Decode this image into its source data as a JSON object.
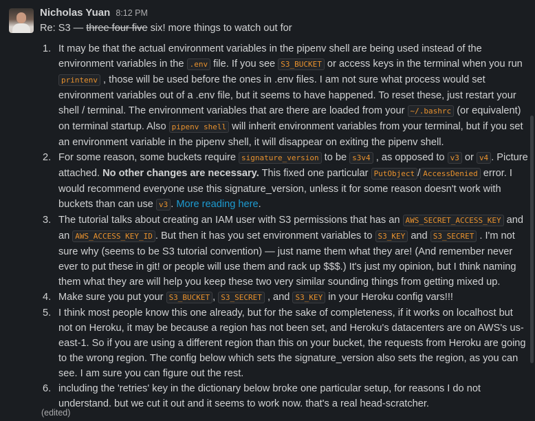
{
  "message": {
    "author": "Nicholas Yuan",
    "time": "8:12 PM",
    "subject": {
      "before": "Re: S3 — ",
      "struck": "three four five",
      "after": " six! more things to watch out for"
    },
    "items": [
      {
        "n": "1.",
        "parts": [
          {
            "t": "It may be that the actual environment variables in the pipenv shell are being used instead of the environment variables in the "
          },
          {
            "c": ".env"
          },
          {
            "t": " file. If you see "
          },
          {
            "c": "S3_BUCKET"
          },
          {
            "t": " or access keys in the terminal when you run "
          },
          {
            "c": "printenv"
          },
          {
            "t": " , those will be used before the ones in .env files. I am not sure what process would set environment variables out of a .env file, but it seems to have happened. To reset these, just restart your shell / terminal. The environment variables that are there are loaded from your "
          },
          {
            "c": "~/.bashrc"
          },
          {
            "t": " (or equivalent) on terminal startup. Also "
          },
          {
            "c": "pipenv shell"
          },
          {
            "t": " will inherit environment variables from your terminal, but if you set an environment variable in the pipenv shell, it will disappear on exiting the pipenv shell."
          }
        ]
      },
      {
        "n": "2.",
        "parts": [
          {
            "t": "For some reason, some buckets require "
          },
          {
            "c": "signature_version"
          },
          {
            "t": " to be "
          },
          {
            "c": "s3v4"
          },
          {
            "t": " , as opposed to "
          },
          {
            "c": "v3"
          },
          {
            "t": " or "
          },
          {
            "c": "v4"
          },
          {
            "t": ". Picture attached. "
          },
          {
            "b": "No other changes are necessary."
          },
          {
            "t": " This fixed one particular "
          },
          {
            "c": "PutObject"
          },
          {
            "t": "/"
          },
          {
            "c": "AccessDenied"
          },
          {
            "t": " error. I would recommend everyone use this signature_version, unless it for some reason doesn't work with buckets than can use "
          },
          {
            "c": "v3"
          },
          {
            "t": ". "
          },
          {
            "a": "More reading here"
          },
          {
            "t": "."
          }
        ]
      },
      {
        "n": "3.",
        "parts": [
          {
            "t": "The tutorial talks about creating an IAM user with S3 permissions that has an "
          },
          {
            "c": "AWS_SECRET_ACCESS_KEY"
          },
          {
            "t": " and an "
          },
          {
            "c": "AWS_ACCESS_KEY_ID"
          },
          {
            "t": ". But then it has you set environment variables to "
          },
          {
            "c": "S3_KEY"
          },
          {
            "t": " and "
          },
          {
            "c": "S3_SECRET"
          },
          {
            "t": " . I'm not sure why (seems to be S3 tutorial convention) — just name them what they are! (And remember never ever to put these in git! or people will use them and rack up $$$.) It's just my opinion, but I think naming them what they are will help you keep these two very similar sounding things from getting mixed up."
          }
        ]
      },
      {
        "n": "4.",
        "parts": [
          {
            "t": "Make sure you put your "
          },
          {
            "c": "S3_BUCKET"
          },
          {
            "t": ", "
          },
          {
            "c": "S3_SECRET"
          },
          {
            "t": " , and "
          },
          {
            "c": "S3_KEY"
          },
          {
            "t": " in your Heroku config vars!!!"
          }
        ]
      },
      {
        "n": "5.",
        "parts": [
          {
            "t": "I think most people know this one already, but for the sake of completeness, if it works on localhost but not on Heroku, it may be because a region has not been set, and Heroku's datacenters are on AWS's us-east-1. So if you are using a different region than this on your bucket, the requests from Heroku are going to the wrong region. The config below which sets the signature_version also sets the region, as you can see. I am sure you can figure out the rest."
          }
        ]
      },
      {
        "n": "6.",
        "parts": [
          {
            "t": "including the 'retries' key in the dictionary below broke one particular setup, for reasons I do not understand. but we cut it out and it seems to work now. that's a real head-scratcher."
          }
        ]
      }
    ],
    "edited": "(edited)"
  }
}
